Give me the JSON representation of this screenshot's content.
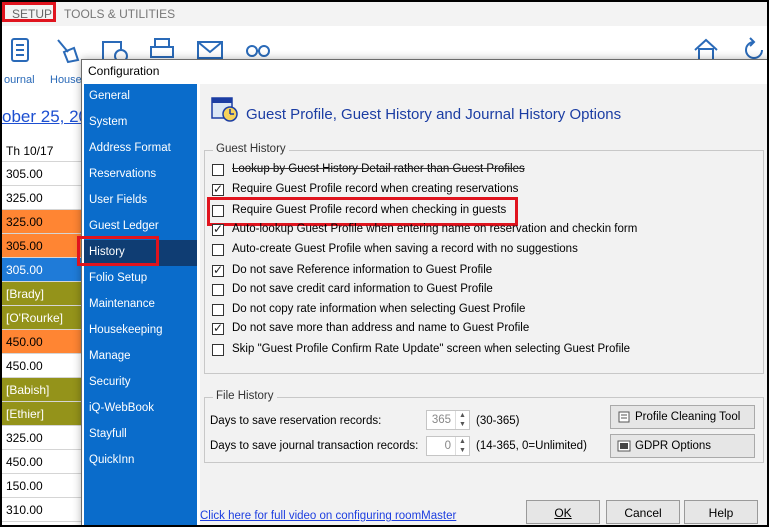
{
  "app": {
    "menu": {
      "setup": "SETUP",
      "tools": "TOOLS & UTILITIES"
    },
    "toolbar": {
      "journal": "ournal",
      "house": "House"
    },
    "date": "ober 25, 20",
    "grid": [
      "Th 10/17",
      "305.00",
      "325.00",
      "325.00",
      "305.00",
      "305.00",
      "[Brady]",
      "[O'Rourke]",
      "450.00",
      "450.00",
      "[Babish]",
      "[Ethier]",
      "325.00",
      "450.00",
      "150.00",
      "310.00"
    ],
    "grid_colors": {
      "orange": "#ff8533",
      "blue": "#1f7bd8",
      "olive": "#94931a"
    }
  },
  "dialog": {
    "title": "Configuration",
    "nav": [
      "General",
      "System",
      "Address Format",
      "Reservations",
      "User Fields",
      "Guest Ledger",
      "History",
      "Folio Setup",
      "Maintenance",
      "Housekeeping",
      "Manage",
      "Security",
      "iQ-WebBook",
      "Stayfull",
      "QuickInn"
    ],
    "selected_nav": "History",
    "header_title": "Guest Profile, Guest History and Journal History Options",
    "guest_history": {
      "title": "Guest History",
      "options": [
        {
          "label": "Lookup by Guest History Detail rather than Guest Profiles",
          "checked": false
        },
        {
          "label": "Require Guest Profile record when creating reservations",
          "checked": true
        },
        {
          "label": "Require Guest Profile record when checking in guests",
          "checked": false
        },
        {
          "label": "Auto-lookup Guest Profile when entering name on reservation and checkin form",
          "checked": true
        },
        {
          "label": "Auto-create Guest Profile when saving a record with no suggestions",
          "checked": false
        },
        {
          "label": "Do not save Reference information to Guest Profile",
          "checked": true
        },
        {
          "label": "Do not save credit card information to Guest Profile",
          "checked": false
        },
        {
          "label": "Do not copy rate information when selecting Guest Profile",
          "checked": false
        },
        {
          "label": "Do not save more than address and name to Guest Profile",
          "checked": true
        },
        {
          "label": "Skip \"Guest Profile Confirm Rate Update\" screen when selecting Guest Profile",
          "checked": false
        }
      ]
    },
    "file_history": {
      "title": "File History",
      "reservation_label": "Days to save reservation records:",
      "reservation_value": "365",
      "reservation_range": "(30-365)",
      "journal_label": "Days to save journal transaction records:",
      "journal_value": "0",
      "journal_range": "(14-365, 0=Unlimited)",
      "profile_cleaning": "Profile Cleaning Tool",
      "gdpr": "GDPR Options"
    },
    "video_link": "Click here for full video on configuring roomMaster",
    "buttons": {
      "ok": "OK",
      "cancel": "Cancel",
      "help": "Help"
    },
    "highlight_color": "#e0141e",
    "nav_color": "#0a6ccb",
    "title_color": "#1b3da3"
  }
}
